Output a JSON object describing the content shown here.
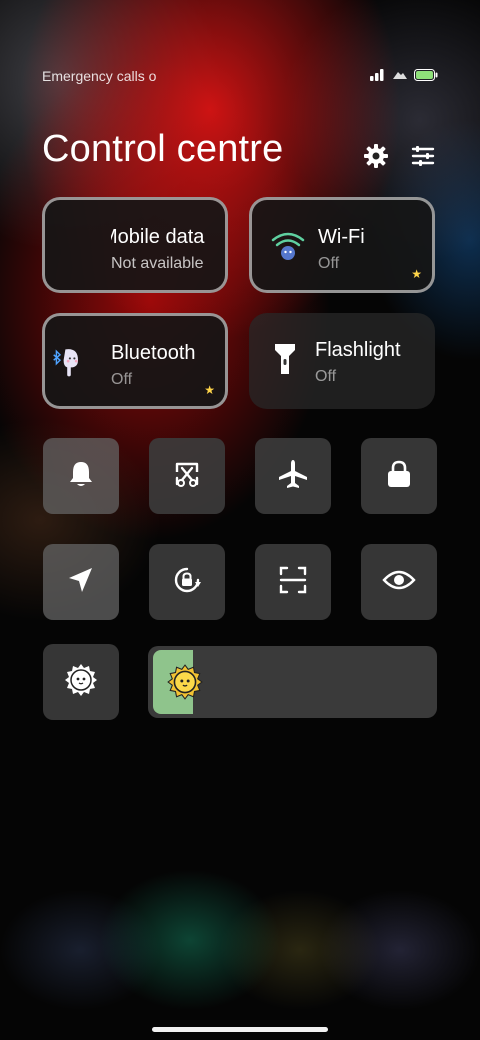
{
  "status_bar": {
    "carrier_text": "Emergency calls o",
    "icons": [
      "signal-icon",
      "cloud-icon",
      "battery-icon"
    ],
    "battery_color": "#8fe07a"
  },
  "header": {
    "title": "Control centre",
    "icons": [
      "settings-icon",
      "edit-tiles-icon"
    ]
  },
  "tiles": [
    {
      "name": "Mobile data",
      "status": "Not available",
      "icon": "mobile-data-icon",
      "favorite": false
    },
    {
      "name": "Wi-Fi",
      "status": "Off",
      "icon": "wifi-icon",
      "favorite": true
    },
    {
      "name": "Bluetooth",
      "status": "Off",
      "icon": "bluetooth-icon",
      "favorite": true
    },
    {
      "name": "Flashlight",
      "status": "Off",
      "icon": "flashlight-icon",
      "favorite": false
    }
  ],
  "quick_toggles": [
    {
      "icon": "bell-icon",
      "active": true
    },
    {
      "icon": "screenshot-icon",
      "active": false
    },
    {
      "icon": "airplane-icon",
      "active": false
    },
    {
      "icon": "lock-icon",
      "active": false
    },
    {
      "icon": "location-icon",
      "active": true
    },
    {
      "icon": "rotation-lock-icon",
      "active": false
    },
    {
      "icon": "scan-icon",
      "active": false
    },
    {
      "icon": "eye-icon",
      "active": false
    }
  ],
  "brightness": {
    "auto_icon": "auto-brightness-icon",
    "level": 0.14,
    "fill_color": "#8fc48c"
  },
  "colors": {
    "accent_red": "#d41414",
    "star": "#ffd54a"
  }
}
